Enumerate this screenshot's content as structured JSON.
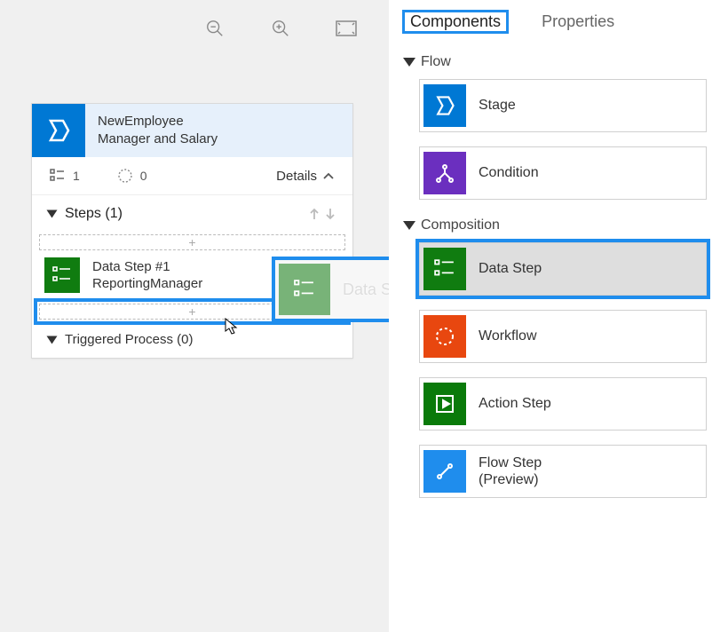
{
  "toolbar": {
    "zoom_out": "zoom-out",
    "zoom_in": "zoom-in",
    "fit": "fit-screen"
  },
  "stage": {
    "title_line1": "NewEmployee",
    "title_line2": "Manager and Salary",
    "count_label": "1",
    "cycle_label": "0",
    "details_label": "Details"
  },
  "steps": {
    "header": "Steps (1)",
    "drop_plus": "+",
    "item1_line1": "Data Step #1",
    "item1_line2": "ReportingManager",
    "triggered": "Triggered Process (0)"
  },
  "drag_ghost": {
    "label": "Data Step"
  },
  "tabs": {
    "components": "Components",
    "properties": "Properties"
  },
  "sections": {
    "flow": "Flow",
    "composition": "Composition"
  },
  "components": {
    "stage": "Stage",
    "condition": "Condition",
    "data_step": "Data Step",
    "workflow": "Workflow",
    "action_step": "Action Step",
    "flow_step_l1": "Flow Step",
    "flow_step_l2": "(Preview)"
  }
}
